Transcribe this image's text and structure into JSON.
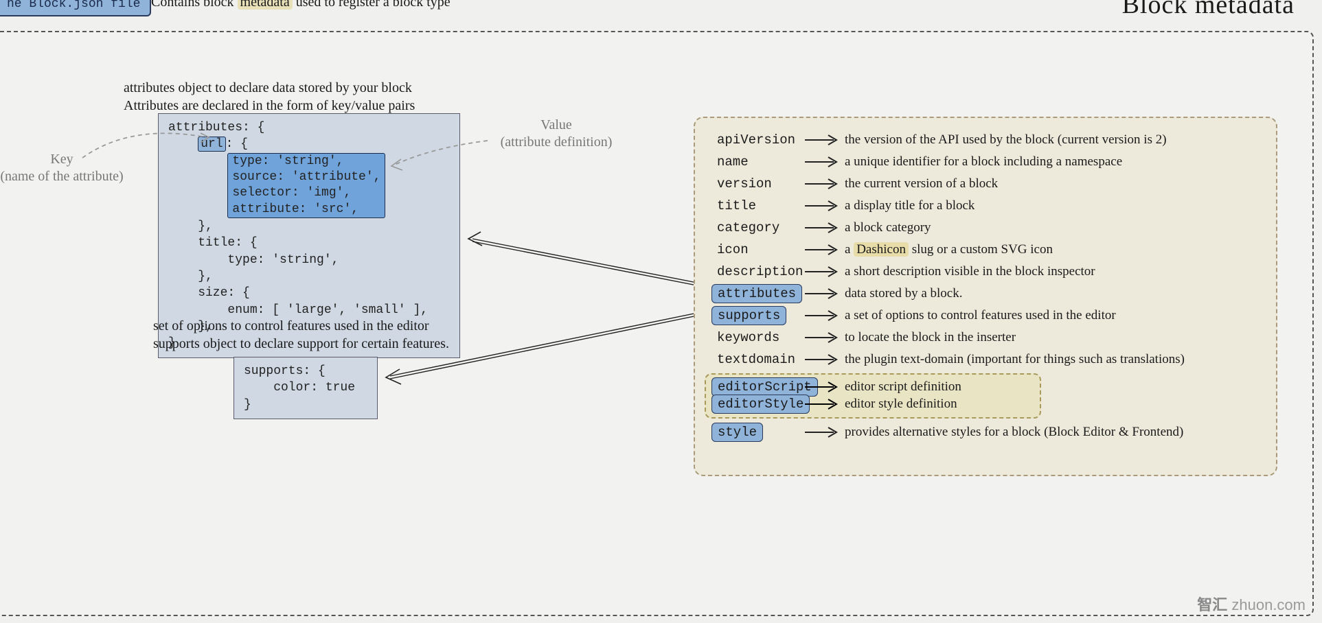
{
  "header": {
    "tag": "he Block.json file",
    "subtitle_pre": "Contains block ",
    "subtitle_hl": "metadata",
    "subtitle_post": " used to register a block type",
    "heading": "Block metadata"
  },
  "attrib": {
    "desc_l1": "attributes object to declare data stored by your block",
    "desc_l2": "Attributes are declared in the form of key/value pairs",
    "code_l0": "attributes: {",
    "code_key": "url",
    "code_key_after": ": {",
    "code_val_1": "type: 'string',",
    "code_val_2": "source: 'attribute',",
    "code_val_3": "selector: 'img',",
    "code_val_4": "attribute: 'src',",
    "code_l2": "    },",
    "code_l3": "    title: {",
    "code_l4": "        type: 'string',",
    "code_l5": "    },",
    "code_l6": "    size: {",
    "code_l7": "        enum: [ 'large', 'small' ],",
    "code_l8": "    },",
    "code_l9": "}"
  },
  "annot": {
    "key_l1": "Key",
    "key_l2": "(name of the attribute)",
    "val_l1": "Value",
    "val_l2": "(attribute definition)"
  },
  "supports": {
    "desc_l1": "set of options to control features used in the editor",
    "desc_l2": "supports object to declare support for certain features.",
    "code_l1": "supports: {",
    "code_l2": "    color: true",
    "code_l3": "}"
  },
  "meta": {
    "rows": [
      {
        "key": "apiVersion",
        "pill": false,
        "desc": "the version of the API used by the block (current version is 2)"
      },
      {
        "key": "name",
        "pill": false,
        "desc": "a unique identifier for a block including a namespace"
      },
      {
        "key": "version",
        "pill": false,
        "desc": "the current version of a block"
      },
      {
        "key": "title",
        "pill": false,
        "desc": "a display title for a block"
      },
      {
        "key": "category",
        "pill": false,
        "desc": "a block category"
      },
      {
        "key": "icon",
        "pill": false,
        "desc_pre": "a ",
        "desc_hl": "Dashicon",
        "desc_post": " slug or a custom SVG icon"
      },
      {
        "key": "description",
        "pill": false,
        "desc": "a short description visible in the block inspector"
      },
      {
        "key": "attributes",
        "pill": true,
        "desc": "data stored by a block."
      },
      {
        "key": "supports",
        "pill": true,
        "desc": "a set of options to control features used in the editor"
      },
      {
        "key": "keywords",
        "pill": false,
        "desc": "to locate the block in the inserter"
      },
      {
        "key": "textdomain",
        "pill": false,
        "desc": "the plugin text-domain (important for things such as translations)"
      }
    ],
    "editor": [
      {
        "key": "editorScript",
        "pill": true,
        "desc": "editor script definition"
      },
      {
        "key": "editorStyle",
        "pill": true,
        "desc": "editor style definition"
      }
    ],
    "style": {
      "key": "style",
      "pill": true,
      "desc": "provides alternative styles for a block (Block Editor & Frontend)"
    }
  },
  "watermark": {
    "bold": "智汇",
    "rest": "zhuon.com"
  }
}
